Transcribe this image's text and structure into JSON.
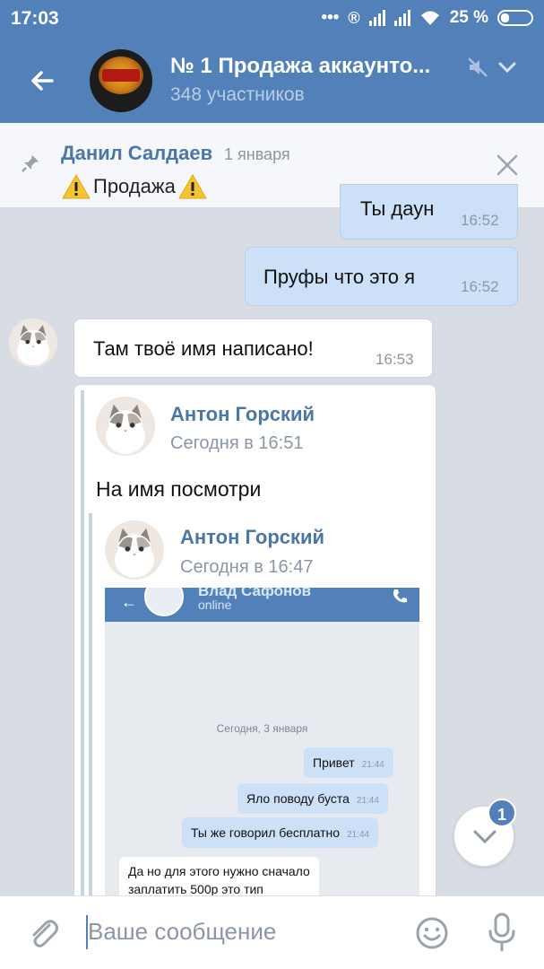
{
  "status_bar": {
    "time": "17:03",
    "battery": "25 %"
  },
  "header": {
    "title": "№ 1 Продажа аккаунто...",
    "subtitle": "348 участников"
  },
  "pinned": {
    "author": "Данил Салдаев",
    "date": "1 января",
    "text": "Продажа"
  },
  "messages": {
    "out1": {
      "text": "Ты даун",
      "time": "16:52"
    },
    "out2": {
      "text": "Пруфы что это я",
      "time": "16:52"
    },
    "in1": {
      "text": "Там твоё имя написано!",
      "time": "16:53"
    }
  },
  "forward1": {
    "author": "Антон Горский",
    "date": "Сегодня в 16:51",
    "text": "На имя посмотри"
  },
  "forward2": {
    "author": "Антон Горский",
    "date": "Сегодня в 16:47"
  },
  "screenshot": {
    "name": "Влад Сафонов",
    "status": "online",
    "date_separator": "Сегодня, 3 января",
    "messages": [
      {
        "text": "Привет",
        "time": "21:44"
      },
      {
        "text": "Яло поводу буста",
        "time": "21:44"
      },
      {
        "text": "Ты же говорил бесплатно",
        "time": "21:44"
      },
      {
        "text_line1": "Да но для этого нужно сначало",
        "text_line2": "заплатить 500р это тип"
      }
    ]
  },
  "fab": {
    "badge": "1"
  },
  "composer": {
    "placeholder": "Ваше сообщение"
  },
  "colors": {
    "header": "#5181b8",
    "outgoing": "#cce0f7",
    "link": "#4a76a8"
  }
}
